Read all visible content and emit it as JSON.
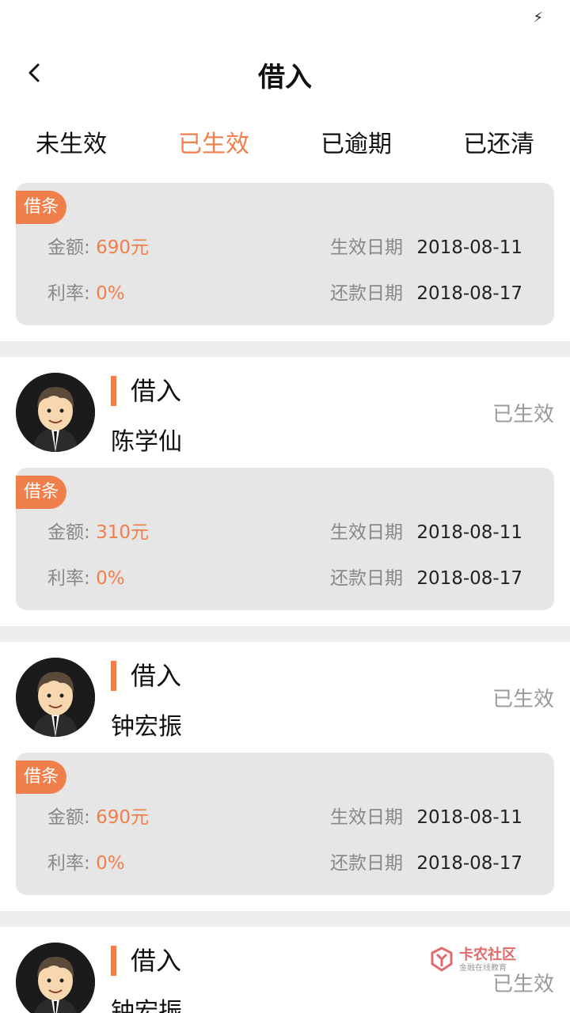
{
  "header": {
    "title": "借入"
  },
  "tabs": [
    "未生效",
    "已生效",
    "已逾期",
    "已还清"
  ],
  "labels": {
    "tag": "借条",
    "amount": "金额:",
    "rate": "利率:",
    "effective_date": "生效日期",
    "repay_date": "还款日期"
  },
  "first_note": {
    "amount": "690元",
    "rate": "0%",
    "effective_date": "2018-08-11",
    "repay_date": "2018-08-17"
  },
  "loans": [
    {
      "type": "借入",
      "name": "陈学仙",
      "status": "已生效",
      "amount": "310元",
      "rate": "0%",
      "effective_date": "2018-08-11",
      "repay_date": "2018-08-17"
    },
    {
      "type": "借入",
      "name": "钟宏振",
      "status": "已生效",
      "amount": "690元",
      "rate": "0%",
      "effective_date": "2018-08-11",
      "repay_date": "2018-08-17"
    },
    {
      "type": "借入",
      "name": "钟宏振",
      "status": "已生效"
    }
  ],
  "watermark": {
    "title": "卡农社区",
    "subtitle": "金融在线教育"
  },
  "colors": {
    "accent": "#f07f4b",
    "note_bg": "#e6e6e6",
    "separator": "#ededee"
  }
}
